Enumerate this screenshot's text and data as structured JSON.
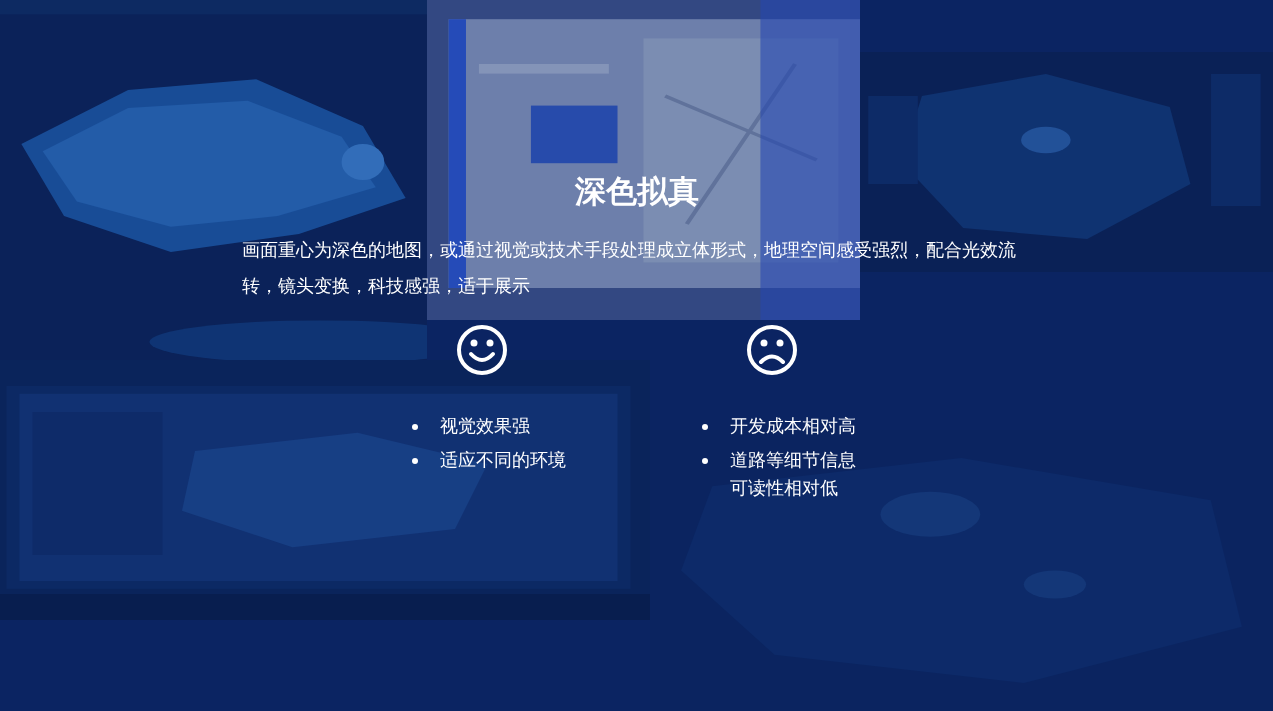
{
  "title": "深色拟真",
  "description": "画面重心为深色的地图，或通过视觉或技术手段处理成立体形式，地理空间感受强烈，配合光效流转，镜头变换，科技感强，适于展示",
  "columns": [
    {
      "kind": "positive",
      "items": [
        "视觉效果强",
        "适应不同的环境"
      ]
    },
    {
      "kind": "negative",
      "items": [
        "开发成本相对高",
        "道路等细节信息可读性相对低"
      ]
    }
  ]
}
